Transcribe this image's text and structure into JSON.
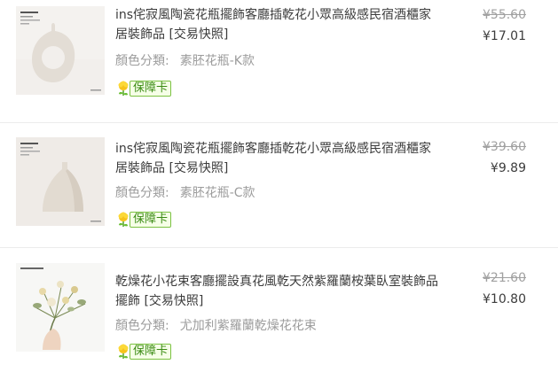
{
  "items": [
    {
      "image_icon": "vase-k-thumbnail",
      "title": "ins侘寂風陶瓷花瓶擺飾客廳插乾花小眾高級感民宿酒櫃家居裝飾品 [交易快照]",
      "variant_label": "顏色分類:",
      "variant_value": "素胚花瓶-K款",
      "badge_icon": "shield-flower-icon",
      "badge_text": "保障卡",
      "price_original": "¥55.60",
      "price_paid": "¥17.01"
    },
    {
      "image_icon": "vase-c-thumbnail",
      "title": "ins侘寂風陶瓷花瓶擺飾客廳插乾花小眾高級感民宿酒櫃家居裝飾品 [交易快照]",
      "variant_label": "顏色分類:",
      "variant_value": "素胚花瓶-C款",
      "badge_icon": "shield-flower-icon",
      "badge_text": "保障卡",
      "price_original": "¥39.60",
      "price_paid": "¥9.89"
    },
    {
      "image_icon": "dried-flower-bouquet-thumbnail",
      "title": "乾燥花小花束客廳擺設真花風乾天然紫羅蘭桉葉臥室裝飾品擺飾 [交易快照]",
      "variant_label": "顏色分類:",
      "variant_value": "尤加利紫羅蘭乾燥花花束",
      "badge_icon": "shield-flower-icon",
      "badge_text": "保障卡",
      "price_original": "¥21.60",
      "price_paid": "¥10.80"
    }
  ],
  "colors": {
    "title": "#3c3c3c",
    "muted": "#9c9c9c",
    "badge_green": "#3a8a13",
    "badge_bg": "#f6ffe7",
    "badge_border": "#7cc142"
  }
}
